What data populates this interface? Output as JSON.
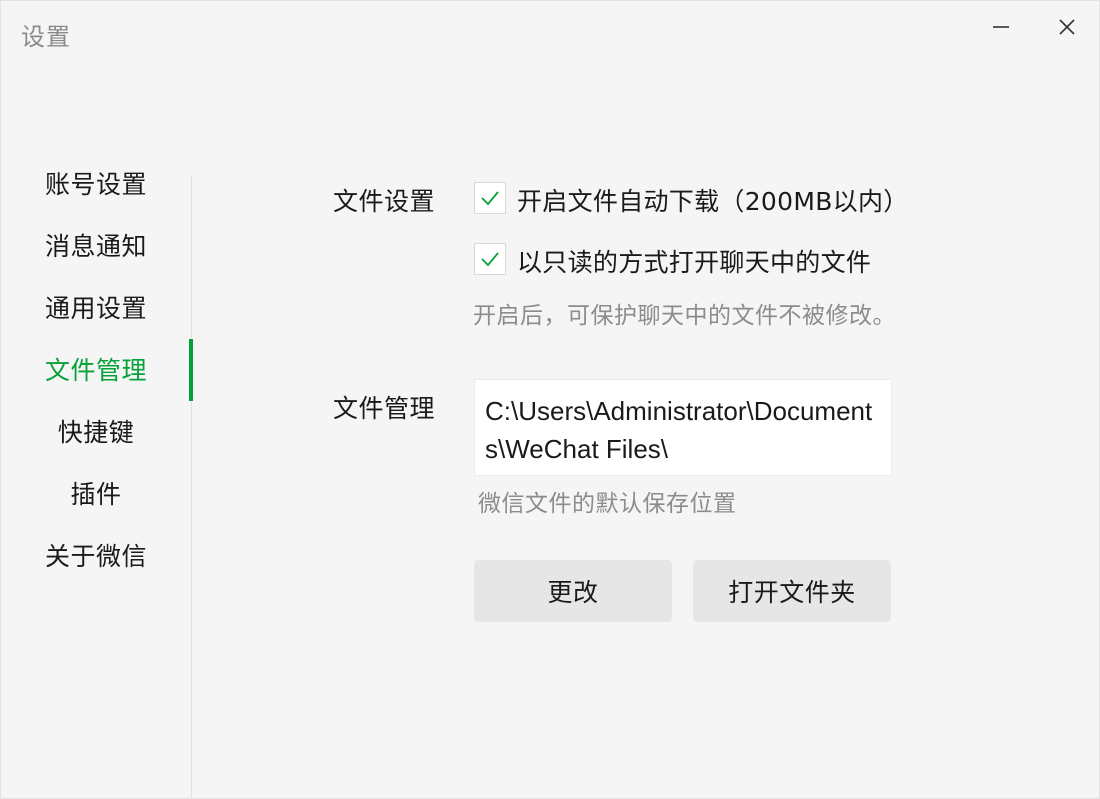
{
  "window": {
    "title": "设置"
  },
  "sidebar": {
    "items": [
      {
        "label": "账号设置"
      },
      {
        "label": "消息通知"
      },
      {
        "label": "通用设置"
      },
      {
        "label": "文件管理"
      },
      {
        "label": "快捷键"
      },
      {
        "label": "插件"
      },
      {
        "label": "关于微信"
      }
    ],
    "active_index": 3
  },
  "file_settings": {
    "section_label": "文件设置",
    "auto_download": {
      "label": "开启文件自动下载（200MB以内）",
      "checked": true
    },
    "read_only": {
      "label": "以只读的方式打开聊天中的文件",
      "checked": true
    },
    "hint": "开启后，可保护聊天中的文件不被修改。"
  },
  "file_management": {
    "section_label": "文件管理",
    "path": "C:\\Users\\Administrator\\Documents\\WeChat Files\\",
    "hint": "微信文件的默认保存位置",
    "change_button": "更改",
    "open_folder_button": "打开文件夹"
  },
  "colors": {
    "accent": "#07a13a",
    "hint_text": "#8c8c8c",
    "button_bg": "#e6e6e6"
  }
}
